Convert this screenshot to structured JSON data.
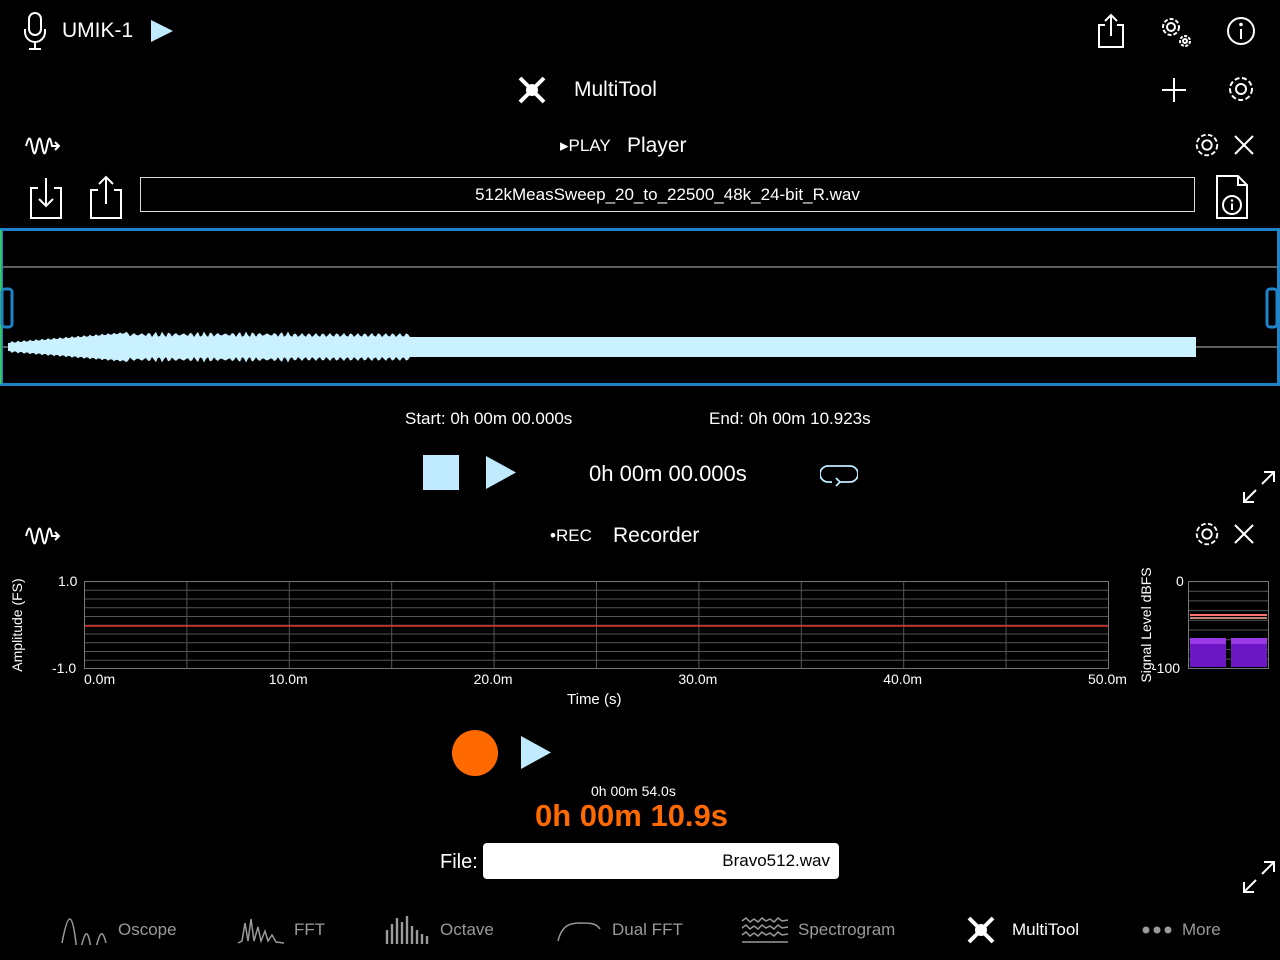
{
  "topbar": {
    "device": "UMIK-1",
    "colors": {
      "accent": "#bfeaff",
      "record": "#ff6a00",
      "waveform": "#c9f1ff",
      "frame": "#1e84c7",
      "mic": "#ffffff"
    }
  },
  "header": {
    "title": "MultiTool"
  },
  "player": {
    "badge": "▸PLAY",
    "title": "Player",
    "filename": "512kMeasSweep_20_to_22500_48k_24-bit_R.wav",
    "start": "Start: 0h 00m 00.000s",
    "end": "End: 0h 00m 10.923s",
    "time": "0h 00m 00.000s"
  },
  "recorder": {
    "badge": "•REC",
    "title": "Recorder",
    "ylabel": "Amplitude (FS)",
    "xlabel": "Time (s)",
    "y_max": "1.0",
    "y_min": "-1.0",
    "x_ticks": [
      "0.0m",
      "10.0m",
      "20.0m",
      "30.0m",
      "40.0m",
      "50.0m"
    ],
    "meter_label": "Signal Level dBFS",
    "meter_top": "0",
    "meter_bottom": "-100",
    "meter_level_fraction": 0.3,
    "total_time": "0h 00m 54.0s",
    "elapsed": "0h 00m 10.9s",
    "file_label": "File:",
    "file_value": "Bravo512.wav"
  },
  "tabs": [
    {
      "label": "Oscope",
      "icon": "oscope-icon"
    },
    {
      "label": "FFT",
      "icon": "fft-icon"
    },
    {
      "label": "Octave",
      "icon": "octave-icon"
    },
    {
      "label": "Dual FFT",
      "icon": "dual-fft-icon"
    },
    {
      "label": "Spectrogram",
      "icon": "spectrogram-icon"
    },
    {
      "label": "MultiTool",
      "icon": "multitool-icon"
    },
    {
      "label": "More",
      "icon": "more-icon"
    }
  ]
}
